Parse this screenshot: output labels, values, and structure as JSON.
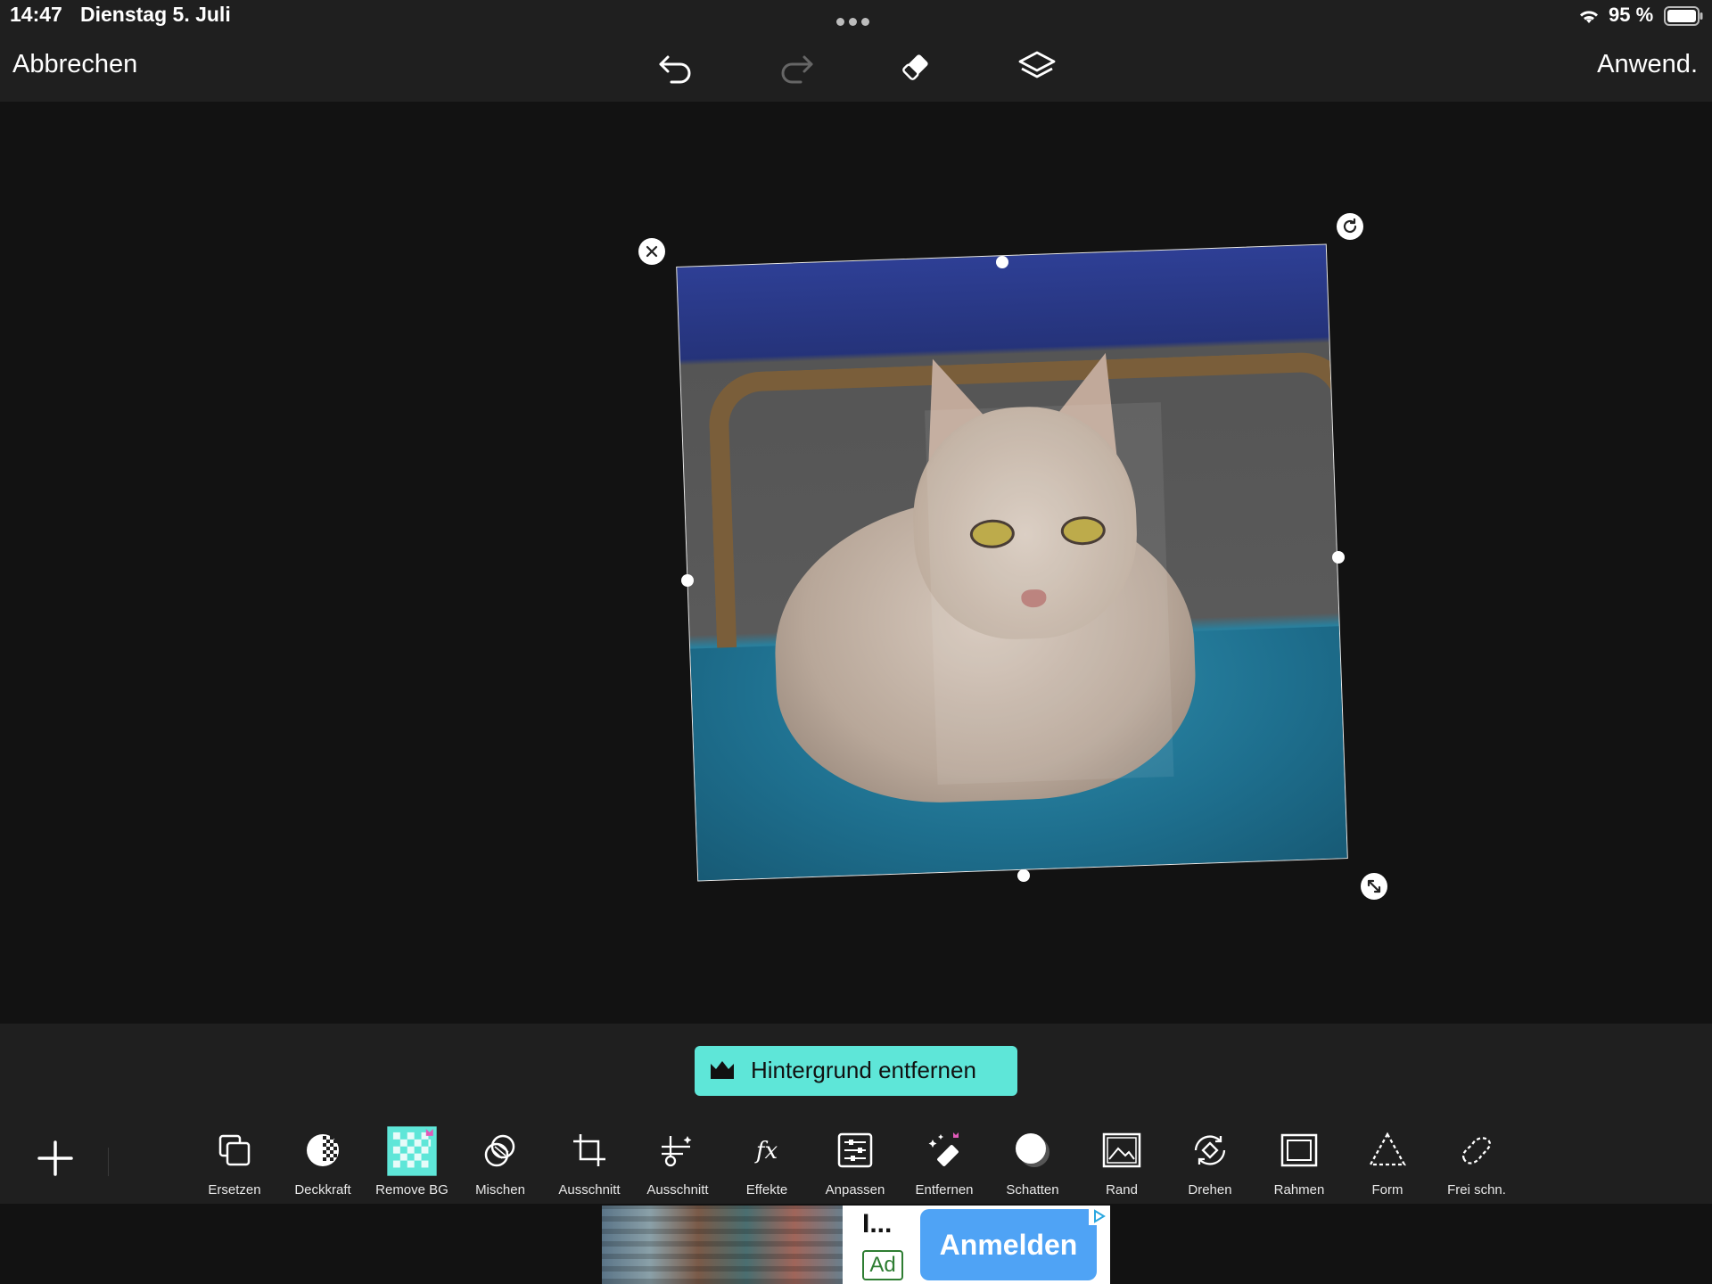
{
  "status_bar": {
    "time": "14:47",
    "date": "Dienstag 5. Juli",
    "battery": "95 %"
  },
  "top_bar": {
    "cancel": "Abbrechen",
    "apply": "Anwend.",
    "icons": [
      "undo-icon",
      "redo-icon",
      "eraser-icon",
      "layers-icon"
    ]
  },
  "action": {
    "remove_background": "Hintergrund entfernen"
  },
  "toolbar": {
    "tools": [
      {
        "label": "Ersetzen",
        "icon": "replace-icon"
      },
      {
        "label": "Deckkraft",
        "icon": "opacity-icon"
      },
      {
        "label": "Remove BG",
        "icon": "remove-bg-icon"
      },
      {
        "label": "Mischen",
        "icon": "blend-icon"
      },
      {
        "label": "Ausschnitt",
        "icon": "crop-icon"
      },
      {
        "label": "Ausschnitt",
        "icon": "cutout-icon"
      },
      {
        "label": "Effekte",
        "icon": "fx-icon"
      },
      {
        "label": "Anpassen",
        "icon": "adjust-icon"
      },
      {
        "label": "Entfernen",
        "icon": "remove-icon"
      },
      {
        "label": "Schatten",
        "icon": "shadow-icon"
      },
      {
        "label": "Rand",
        "icon": "border-icon"
      },
      {
        "label": "Drehen",
        "icon": "rotate-icon"
      },
      {
        "label": "Rahmen",
        "icon": "frame-icon"
      },
      {
        "label": "Form",
        "icon": "shape-icon"
      },
      {
        "label": "Frei schn.",
        "icon": "freecut-icon"
      }
    ]
  },
  "ad": {
    "title": "I...",
    "badge": "Ad",
    "cta": "Anmelden"
  },
  "colors": {
    "accent": "#5ee6d8",
    "background": "#121212",
    "bar": "#1f1f1f",
    "ad_cta": "#4fa3f5"
  }
}
